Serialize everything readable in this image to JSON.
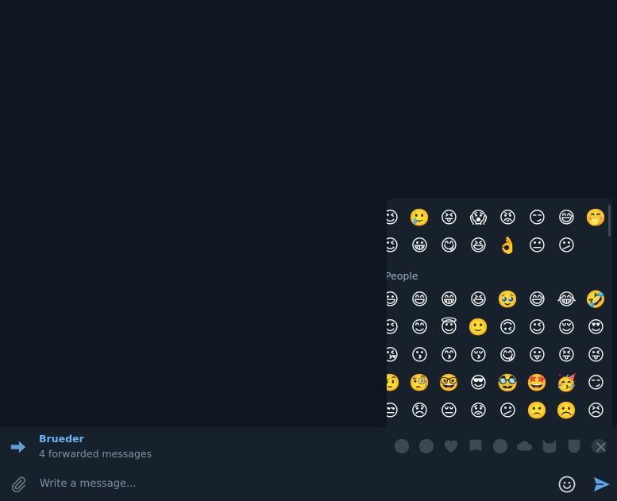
{
  "forward": {
    "title": "Brueder",
    "subtitle": "4 forwarded messages"
  },
  "composer": {
    "placeholder": "Write a message..."
  },
  "emoji_panel": {
    "section_label": "People",
    "recent_rows": [
      [
        "😉",
        "🥲",
        "😝",
        "😱",
        "😡",
        "😏",
        "😅",
        "🤭"
      ],
      [
        "😉",
        "😀",
        "😋",
        "😆",
        "👌",
        "😐",
        "😕",
        ""
      ]
    ],
    "people_rows": [
      [
        "😃",
        "😄",
        "😁",
        "😆",
        "🥹",
        "😅",
        "😂",
        "🤣"
      ],
      [
        "😉",
        "😊",
        "😇",
        "🙂",
        "🙃",
        "😉",
        "😌",
        "😍"
      ],
      [
        "😘",
        "😗",
        "😙",
        "😚",
        "😋",
        "😛",
        "😝",
        "😜"
      ],
      [
        "🤨",
        "🧐",
        "🤓",
        "😎",
        "🥸",
        "🤩",
        "🥳",
        "😏"
      ],
      [
        "😒",
        "😞",
        "😔",
        "😟",
        "😕",
        "🙁",
        "☹️",
        "😣"
      ]
    ],
    "categories": [
      "smileys-icon",
      "people-icon",
      "heart-icon",
      "flag-icon",
      "food-icon",
      "cloud-icon",
      "cat-icon",
      "shield-icon",
      "sticker-icon"
    ]
  },
  "colors": {
    "background": "#0e1621",
    "panel": "#17212b",
    "accent": "#6ab2f2",
    "muted": "#7f91a4"
  }
}
